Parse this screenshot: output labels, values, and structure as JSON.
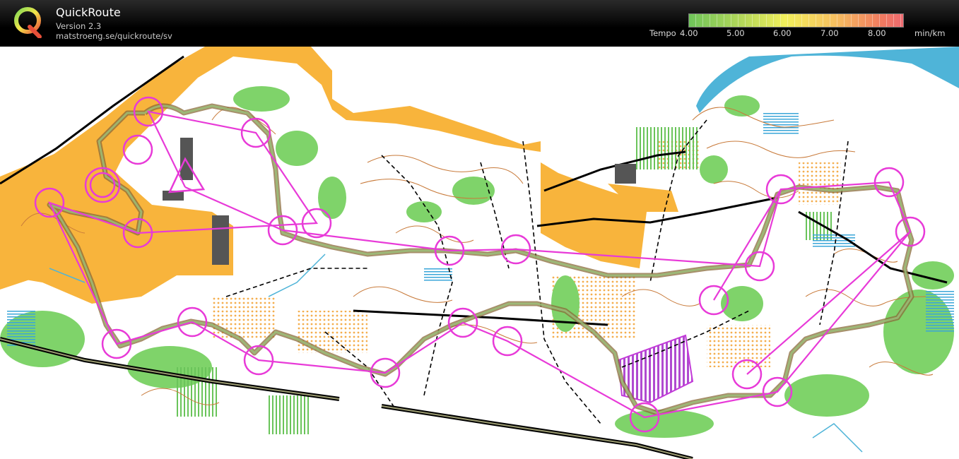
{
  "app": {
    "title": "QuickRoute",
    "version": "Version 2.3",
    "url": "matstroeng.se/quickroute/sv"
  },
  "legend": {
    "label": "Tempo",
    "ticks": [
      "4.00",
      "5.00",
      "6.00",
      "7.00",
      "8.00"
    ],
    "unit": "min/km"
  },
  "colors": {
    "course": "#e83ad8",
    "open_land": "#f8b43c",
    "forest_green": "#7fd36a",
    "water": "#4fb4d8",
    "contour": "#c87a3a",
    "route_slow": "#c05a3a",
    "route_fast": "#6a8a3a"
  }
}
